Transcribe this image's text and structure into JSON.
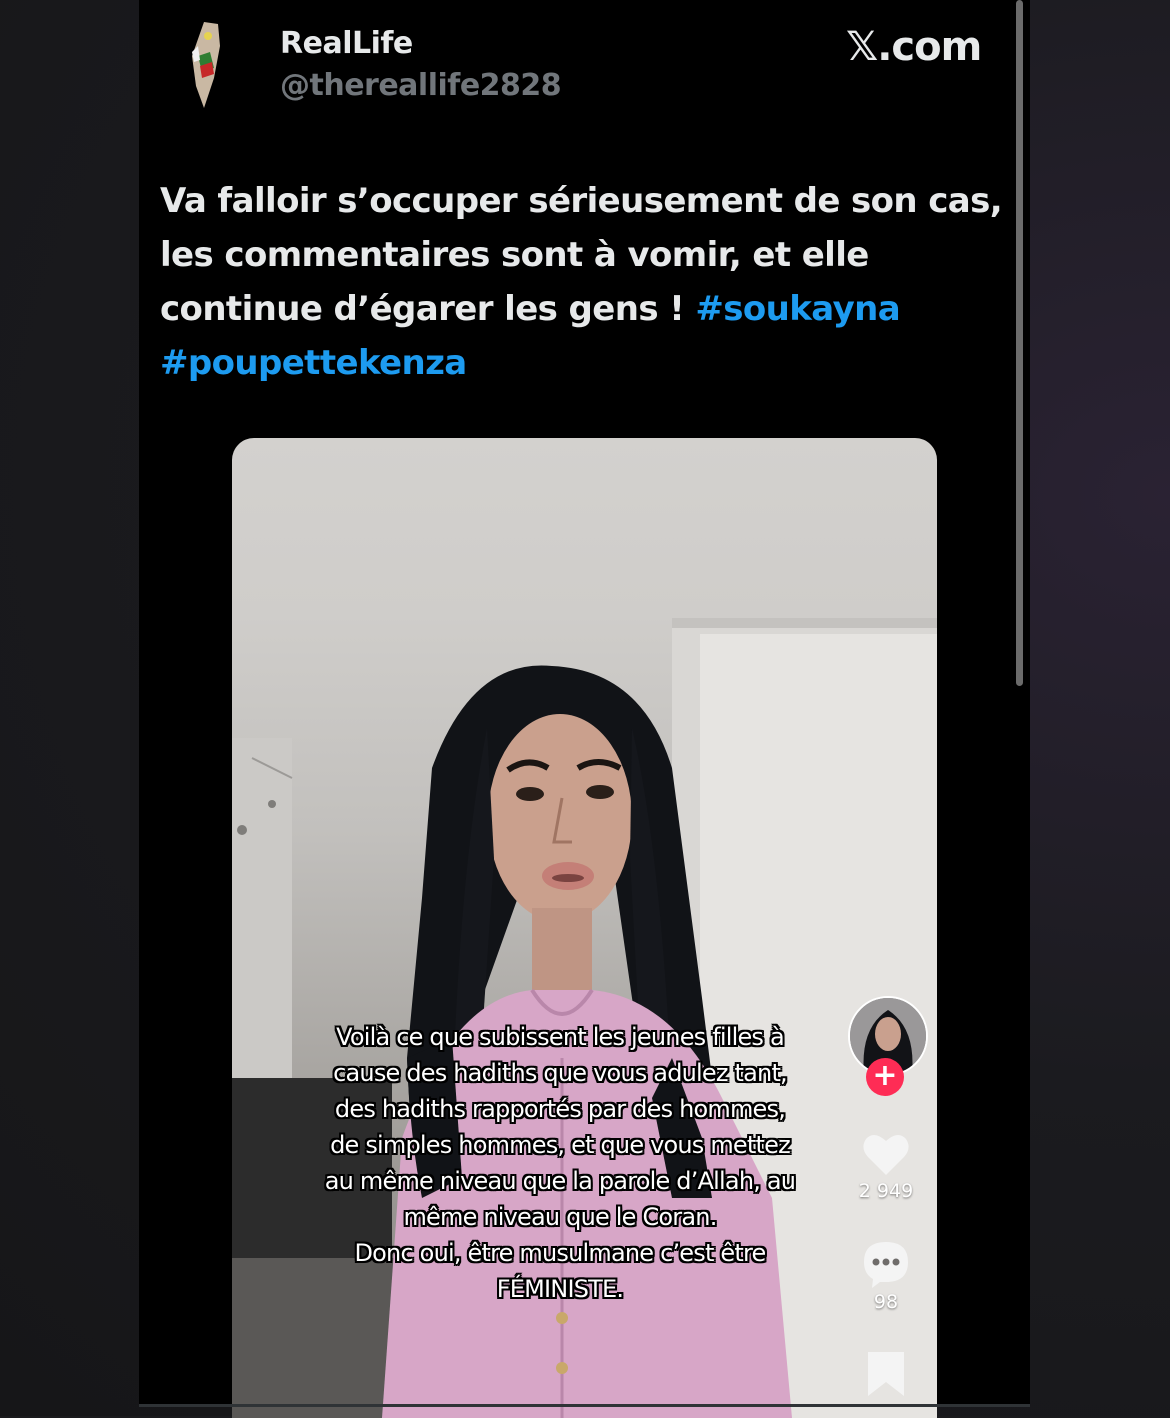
{
  "post": {
    "display_name": "RealLife",
    "handle": "@thereallife2828",
    "site_logo": "𝕏.com",
    "text_line_1": "Va falloir s’occuper sérieusement de son cas,",
    "text_line_2": "les commentaires sont à vomir, et elle",
    "text_line_3": "continue d’égarer les gens ! ",
    "hashtag_1": "#soukayna",
    "hashtag_2": "#poupettekenza",
    "hashtag_color": "#1d9bf0"
  },
  "video": {
    "caption_lines": [
      "Voilà ce que subissent les jeunes filles à",
      "cause des hadiths que vous adulez tant,",
      "des hadiths rapportés par des hommes,",
      "de simples hommes, et que vous mettez",
      "au même niveau que la parole d’Allah, au",
      "même niveau que le Coran.",
      "Donc oui, être musulmane c’est être",
      "FÉMINISTE."
    ],
    "follow_symbol": "+",
    "like_count": "2 949",
    "comment_count": "98",
    "icons": {
      "like": "heart-icon",
      "comment": "comment-bubble-icon",
      "save": "bookmark-icon",
      "follow": "plus-icon"
    },
    "follow_color": "#fe2c55"
  }
}
